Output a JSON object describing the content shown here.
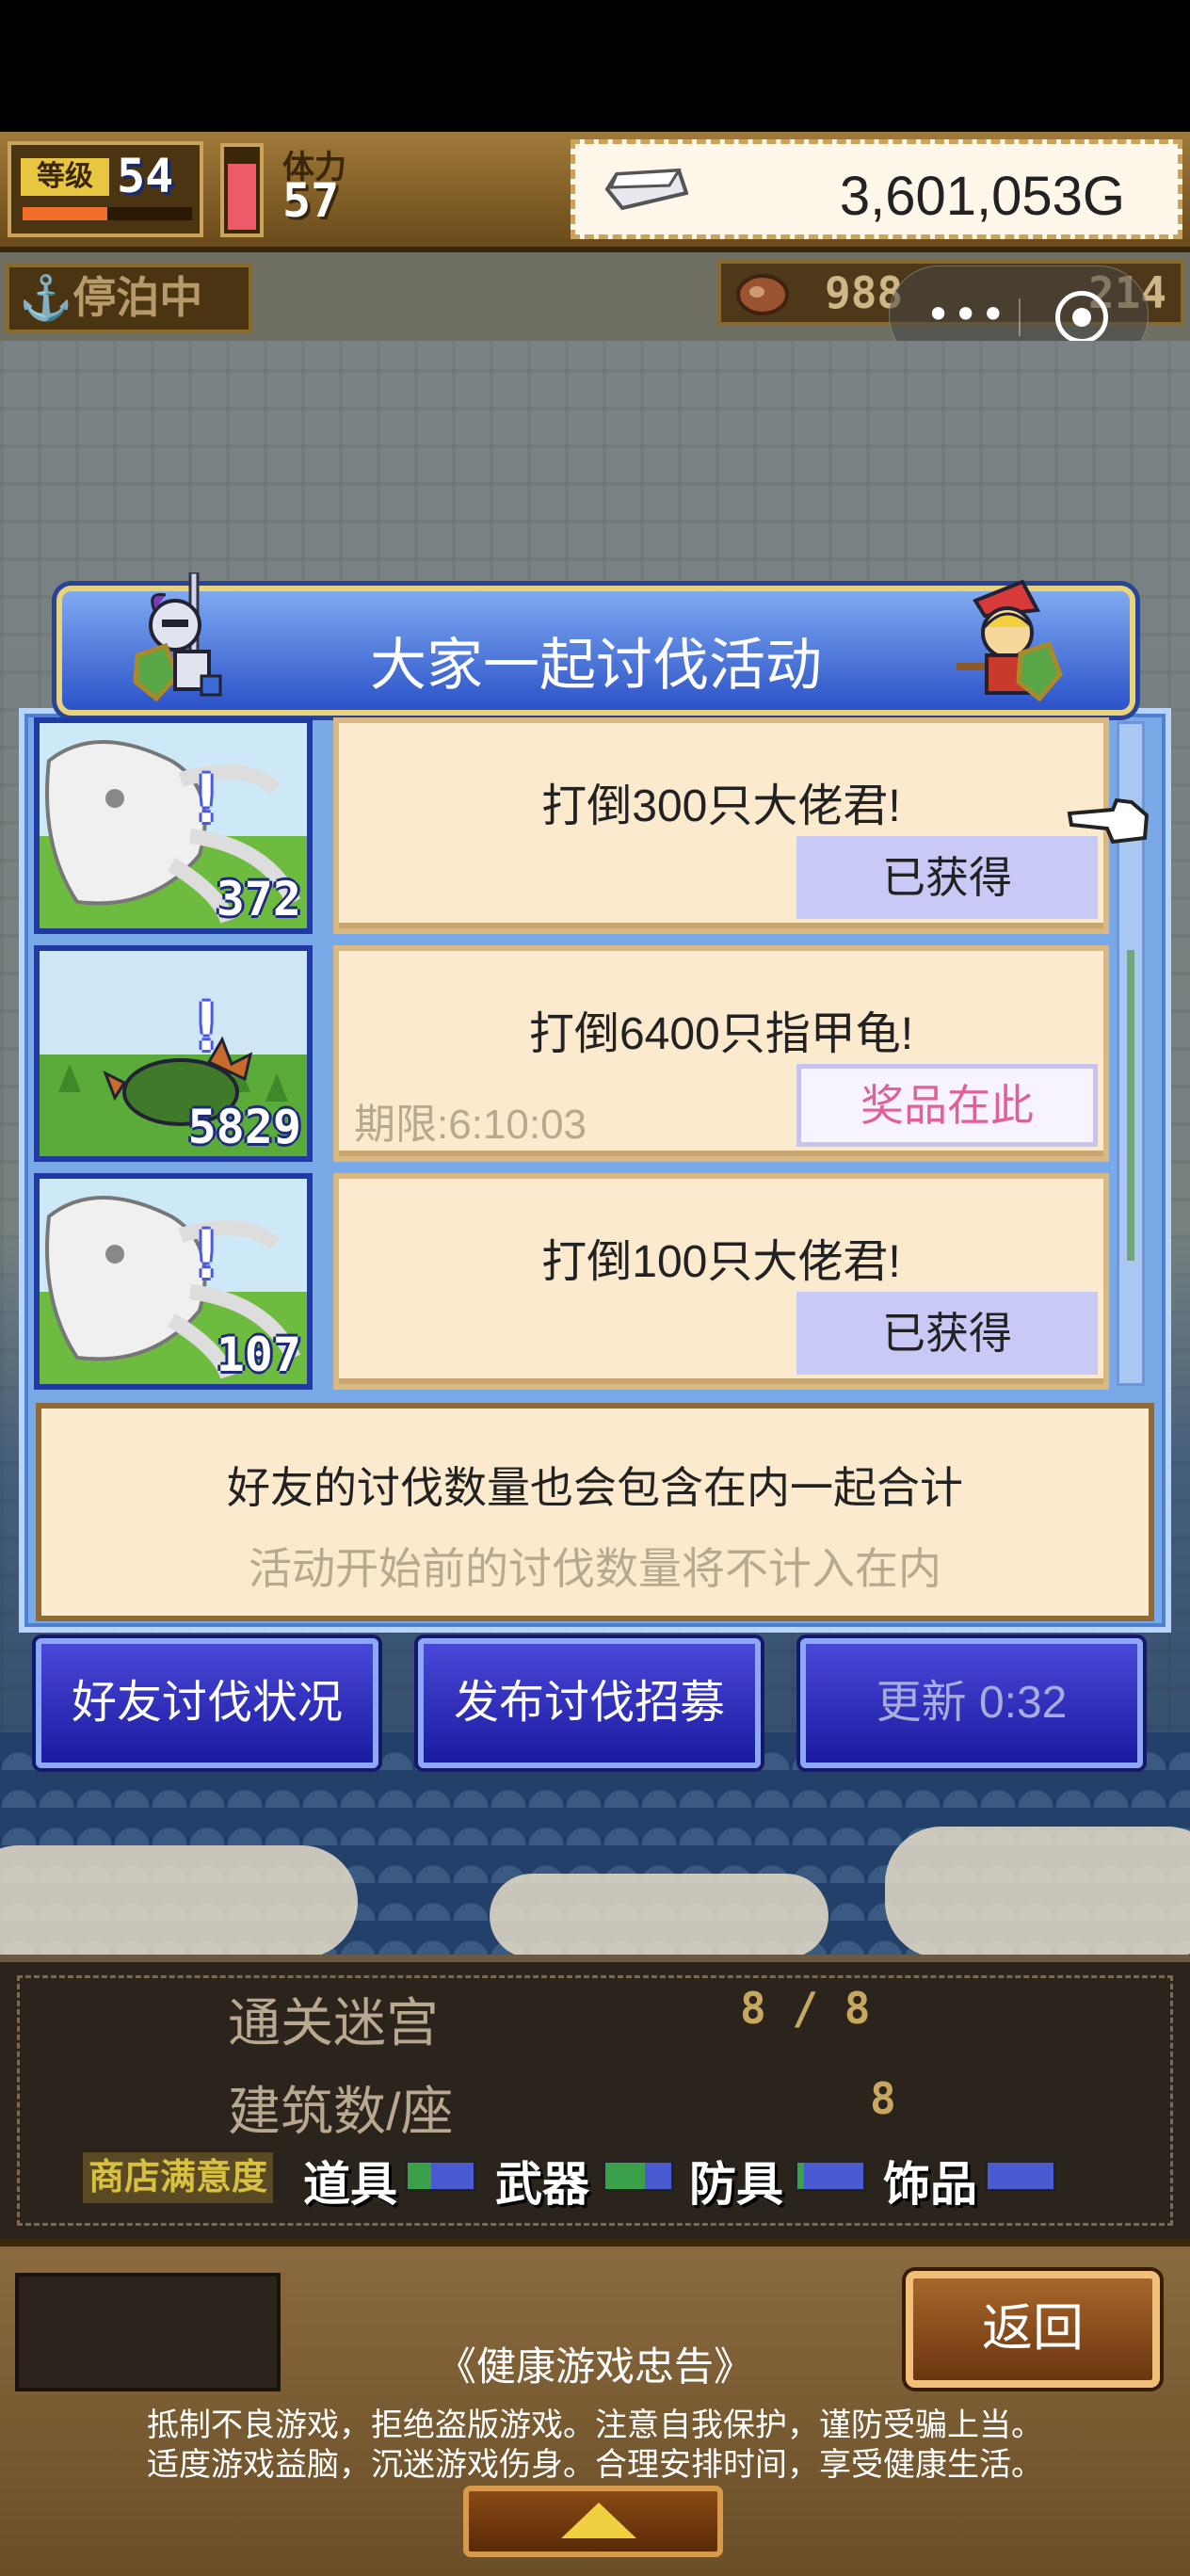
{
  "player": {
    "level_label": "等级",
    "level": "54",
    "level_progress": 0.5,
    "hp_fill": 0.85,
    "stamina_label": "体力",
    "stamina": "57",
    "gold": "3,601,053G"
  },
  "status": {
    "docked": "⚓停泊中",
    "resource_a": "988",
    "resource_b": "214"
  },
  "miniprogram": {
    "more_icon": "•••",
    "close_icon": "target-icon"
  },
  "event": {
    "title": "大家一起讨伐活动",
    "quests": [
      {
        "monster": "squid",
        "count": "372",
        "text": "打倒300只大佬君!",
        "deadline": "",
        "button": "已获得",
        "state": "obtained"
      },
      {
        "monster": "turtle",
        "count": "5829",
        "text": "打倒6400只指甲龟!",
        "deadline": "期限:6:10:03",
        "button": "奖品在此",
        "state": "prize"
      },
      {
        "monster": "squid",
        "count": "107",
        "text": "打倒100只大佬君!",
        "deadline": "",
        "button": "已获得",
        "state": "obtained"
      }
    ],
    "info_main": "好友的讨伐数量也会包含在内一起合计",
    "info_sub": "活动开始前的讨伐数量将不计入在内",
    "buttons": {
      "friends_status": "好友讨伐状况",
      "post_recruit": "发布讨伐招募",
      "refresh": "更新 0:32"
    }
  },
  "stats": {
    "dungeon_label": "通关迷宫",
    "dungeon_value": "8 / 8",
    "building_label": "建筑数/座",
    "building_value": "8",
    "satisfaction_label": "商店满意度",
    "categories": [
      {
        "name": "道具",
        "fill": 0.35
      },
      {
        "name": "武器",
        "fill": 0.6
      },
      {
        "name": "防具",
        "fill": 0.1
      },
      {
        "name": "饰品",
        "fill": 0.0
      }
    ]
  },
  "footer": {
    "back": "返回",
    "notice_title": "《健康游戏忠告》",
    "notice_line1": "抵制不良游戏，拒绝盗版游戏。注意自我保护，谨防受骗上当。",
    "notice_line2": "适度游戏益脑，沉迷游戏伤身。合理安排时间，享受健康生活。"
  },
  "colors": {
    "panel_blue": "#7aa9e8",
    "button_blue": "#1a1aa0",
    "prize_pink": "#e0609a",
    "obtained_lavender": "#c9c9f5"
  }
}
